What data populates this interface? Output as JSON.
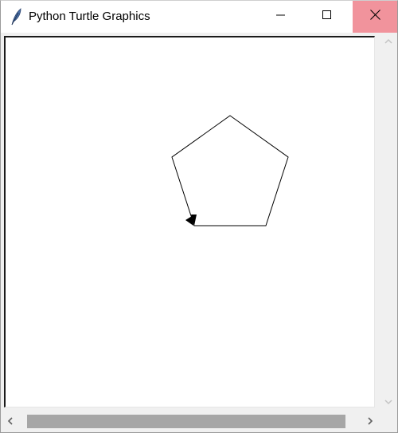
{
  "window": {
    "title": "Python Turtle Graphics",
    "app_icon": "feather-icon",
    "controls": {
      "minimize_icon": "minimize-icon",
      "maximize_icon": "maximize-icon",
      "close_icon": "close-icon",
      "close_hover_color": "#f1939c"
    }
  },
  "canvas": {
    "background": "#ffffff",
    "shape": "pentagon",
    "pen_color": "#000000",
    "turtle_icon": "turtle-arrow-cursor-icon"
  },
  "scrollbars": {
    "vertical": {
      "up_icon": "scroll-up-chevron-icon",
      "down_icon": "scroll-down-chevron-icon"
    },
    "horizontal": {
      "left_icon": "scroll-left-chevron-icon",
      "right_icon": "scroll-right-chevron-icon",
      "thumb_color": "#a6a6a6"
    }
  }
}
